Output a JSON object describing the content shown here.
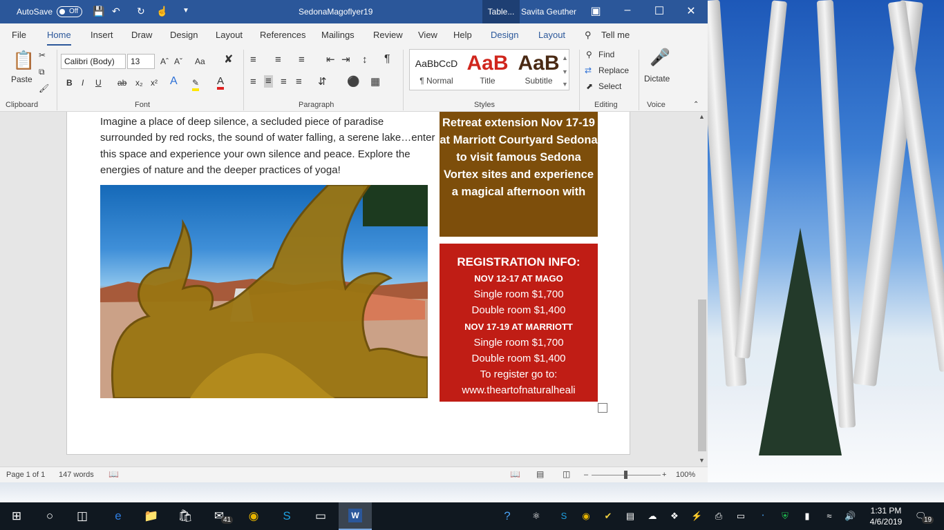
{
  "window": {
    "title": "SedonaMagoflyer19",
    "autosave_label": "AutoSave",
    "autosave_state": "Off",
    "context_tab": "Table...",
    "user": "Savita Geuther"
  },
  "tabs": [
    "File",
    "Home",
    "Insert",
    "Draw",
    "Design",
    "Layout",
    "References",
    "Mailings",
    "Review",
    "View",
    "Help",
    "Design",
    "Layout"
  ],
  "tell_me": "Tell me",
  "ribbon": {
    "clipboard": {
      "paste": "Paste",
      "group": "Clipboard"
    },
    "font": {
      "name": "Calibri (Body)",
      "size": "13",
      "group": "Font",
      "case": "Aa"
    },
    "paragraph": {
      "group": "Paragraph"
    },
    "styles": {
      "group": "Styles",
      "items": [
        {
          "preview": "AaBbCcD",
          "label": "¶ Normal"
        },
        {
          "preview": "AaB",
          "label": "Title"
        },
        {
          "preview": "AaB",
          "label": "Subtitle"
        }
      ]
    },
    "editing": {
      "find": "Find",
      "replace": "Replace",
      "select": "Select",
      "group": "Editing"
    },
    "voice": {
      "dictate": "Dictate",
      "group": "Voice"
    }
  },
  "document": {
    "body": "Imagine a place of deep silence, a secluded piece of paradise surrounded by red rocks, the sound of water falling, a serene lake…enter this space and experience your own silence and peace. Explore the energies of nature and the deeper practices of yoga!",
    "retreat_box": "Retreat extension Nov 17-19 at Marriott Courtyard Sedona to visit famous Sedona Vortex sites and experience a magical afternoon with",
    "registration": {
      "heading": "REGISTRATION INFO:",
      "mago_dates": "NOV 12-17 AT MAGO",
      "mago_single": "Single room $1,700",
      "mago_double": "Double room $1,400",
      "marriott_dates": "NOV 17-19 AT MARRIOTT",
      "marriott_single": "Single room $1,700",
      "marriott_double": "Double room $1,400",
      "register": "To register go to:",
      "url": "www.theartofnaturalheali"
    }
  },
  "status": {
    "page": "Page 1 of 1",
    "words": "147 words",
    "zoom": "100%",
    "zoom_level": 0.5
  },
  "taskbar": {
    "mail_badge": "41",
    "time": "1:31 PM",
    "date": "4/6/2019",
    "notification_count": "19"
  },
  "colors": {
    "title_bar": "#2b579a",
    "retreat_box": "#7d4e0b",
    "registration_box": "#c01d15",
    "taskbar": "#101820"
  }
}
